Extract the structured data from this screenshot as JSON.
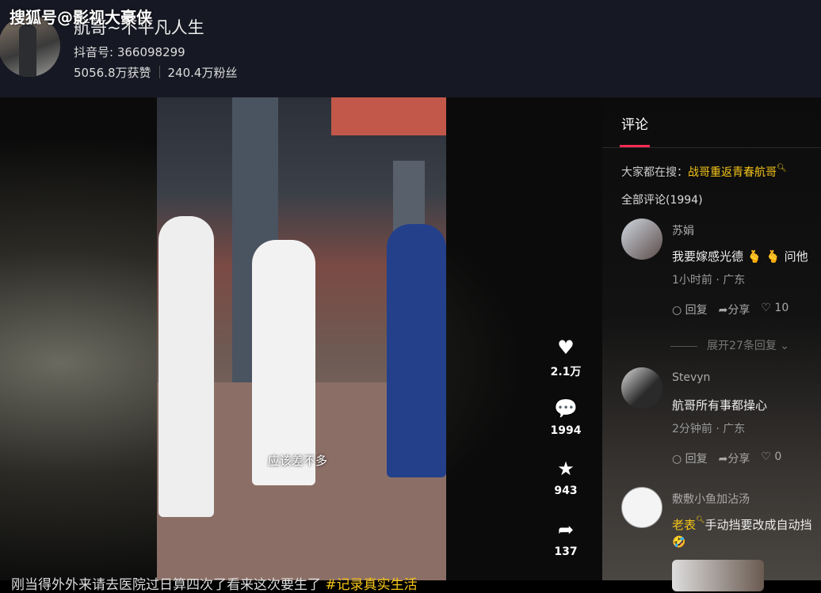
{
  "watermark": "搜狐号@影视大豪侠",
  "profile": {
    "title": "航哥~不平凡人生",
    "uid": "抖音号: 366098299",
    "likes": "5056.8万获赞",
    "fans": "240.4万粉丝"
  },
  "video": {
    "caption": "应该差不多"
  },
  "actions": {
    "like_count": "2.1万",
    "comment_count": "1994",
    "favorite_count": "943",
    "share_count": "137"
  },
  "description": {
    "text": "刚当得外外来请去医院过日算四次了看来这次要生了",
    "tag": "#记录真实生活"
  },
  "comments_panel": {
    "tab": "评论",
    "hot_search_label": "大家都在搜：",
    "hot_search_keyword": "战哥重返青春航哥",
    "total": "全部评论(1994)",
    "reply_label": "回复",
    "share_label": "分享",
    "items": [
      {
        "name": "苏娟",
        "text": "我要嫁感光德 🫰 🫰 问他",
        "time": "1小时前 · 广东",
        "likes": "10",
        "expand": "展开27条回复"
      },
      {
        "name": "Stevyn",
        "text": "航哥所有事都操心",
        "time": "2分钟前 · 广东",
        "likes": "0"
      },
      {
        "name": "敷敷小鱼加沾汤",
        "keyword": "老表",
        "text": "手动挡要改成自动挡",
        "emoji": "🤣"
      }
    ]
  }
}
